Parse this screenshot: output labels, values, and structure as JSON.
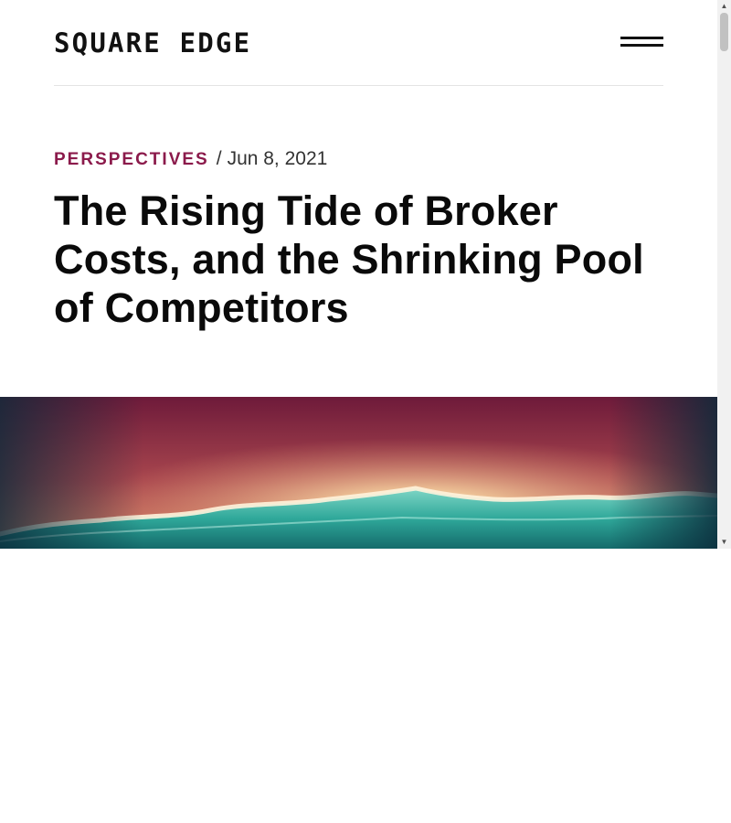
{
  "header": {
    "logo_text": "SQUARE EDGE",
    "menu_icon": "hamburger-menu-icon"
  },
  "article": {
    "category": "PERSPECTIVES",
    "separator": "/",
    "date": "Jun 8, 2021",
    "title": "The Rising Tide of Broker Costs, and the Shrinking Pool of Competitors"
  },
  "hero_image": {
    "subject": "ocean wave at sunset",
    "colors": {
      "sky_top": "#6e1a3a",
      "sky_glow": "#f6d3a0",
      "wave": "#2fa89a"
    }
  },
  "scrollbar": {
    "up_icon": "scroll-up-arrow-icon",
    "down_icon": "scroll-down-arrow-icon"
  },
  "colors": {
    "accent": "#8b1a4b",
    "text": "#0a0a0a",
    "divider": "#e4e4e4"
  }
}
